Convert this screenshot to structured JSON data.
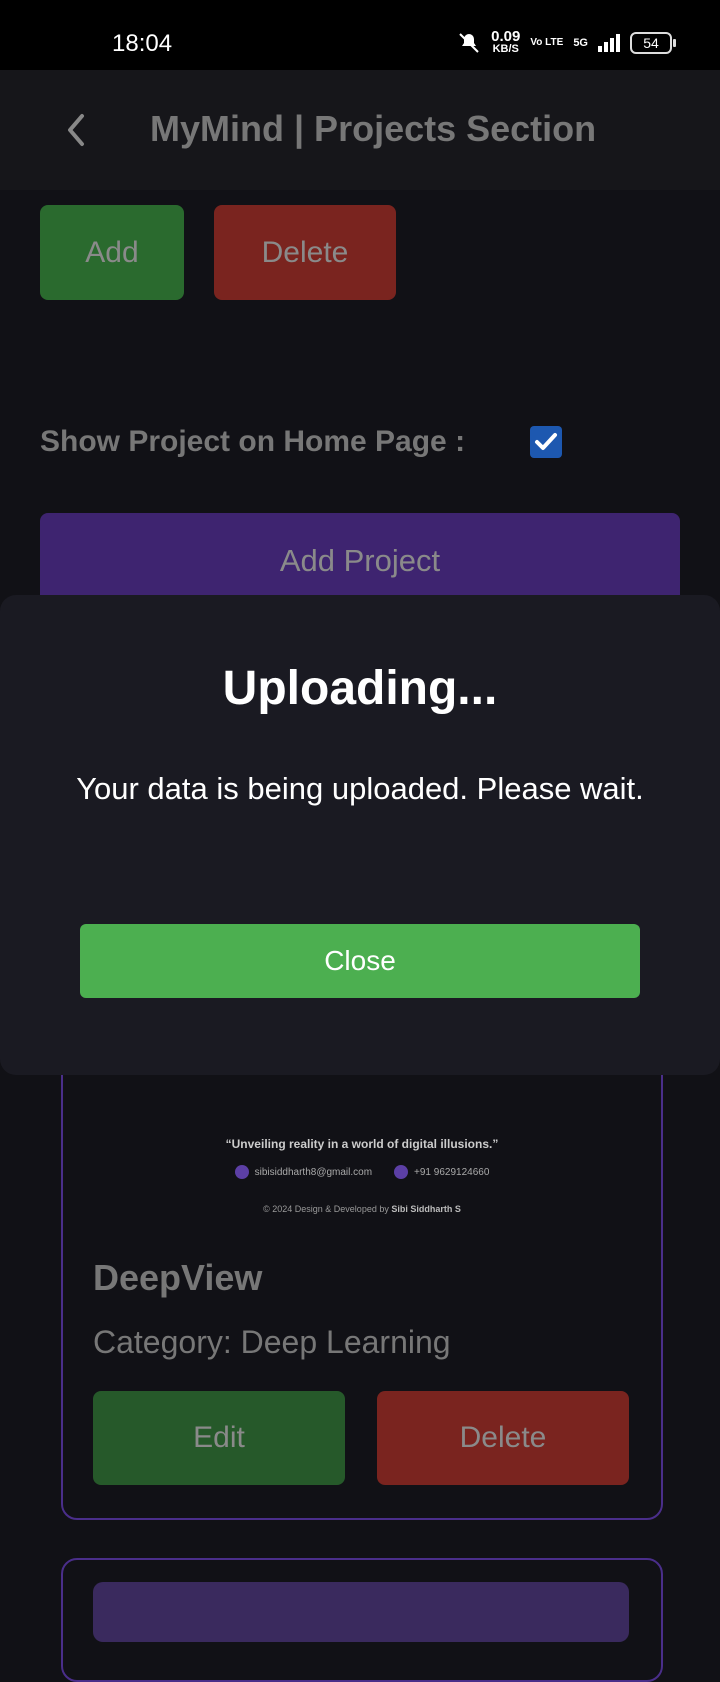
{
  "status_bar": {
    "time": "18:04",
    "net_speed": "0.09",
    "net_unit": "KB/S",
    "volte": "Vo LTE",
    "network": "5G",
    "battery": "54"
  },
  "header": {
    "title": "MyMind | Projects Section"
  },
  "toolbar": {
    "add_label": "Add",
    "delete_label": "Delete"
  },
  "home_toggle": {
    "label": "Show Project on Home Page :",
    "checked": true
  },
  "add_project_label": "Add Project",
  "project_card": {
    "tagline": "“Unveiling reality in a world of digital illusions.”",
    "email": "sibisiddharth8@gmail.com",
    "phone": "+91 9629124660",
    "copyright_prefix": "© 2024 Design & Developed by",
    "copyright_author": "Sibi Siddharth S",
    "name": "DeepView",
    "category": "Category: Deep Learning",
    "edit_label": "Edit",
    "delete_label": "Delete"
  },
  "modal": {
    "title": "Uploading...",
    "message": "Your data is being uploaded. Please wait.",
    "close_label": "Close"
  },
  "colors": {
    "add_green": "#2a6a2e",
    "delete_red": "#7a241f",
    "purple": "#3e2470",
    "close_green": "#4caf50",
    "checkbox_blue": "#1d58b0"
  }
}
